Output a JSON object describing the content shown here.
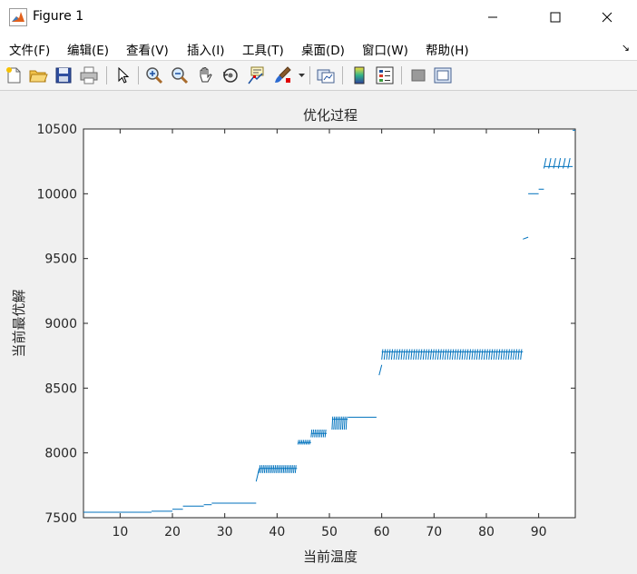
{
  "window": {
    "title": "Figure 1"
  },
  "menu": [
    {
      "label": "文件(F)"
    },
    {
      "label": "编辑(E)"
    },
    {
      "label": "查看(V)"
    },
    {
      "label": "插入(I)"
    },
    {
      "label": "工具(T)"
    },
    {
      "label": "桌面(D)"
    },
    {
      "label": "窗口(W)"
    },
    {
      "label": "帮助(H)"
    }
  ],
  "toolbar_icons": [
    "new-figure-icon",
    "open-folder-icon",
    "save-icon",
    "print-icon",
    "pointer-icon",
    "zoom-in-icon",
    "zoom-out-icon",
    "pan-hand-icon",
    "rotate-3d-icon",
    "data-cursor-icon",
    "brush-icon",
    "link-plot-icon",
    "colorbar-icon",
    "legend-icon",
    "hide-plot-tools-icon",
    "show-plot-tools-icon"
  ],
  "colors": {
    "line": "#0072bd",
    "axes_bg": "#ffffff",
    "figure_bg": "#f0f0f0"
  },
  "chart_data": {
    "type": "line",
    "title": "优化过程",
    "xlabel": "当前温度",
    "ylabel": "当前最优解",
    "xlim": [
      3,
      97
    ],
    "ylim": [
      7500,
      10500
    ],
    "xticks": [
      10,
      20,
      30,
      40,
      50,
      60,
      70,
      80,
      90
    ],
    "yticks": [
      7500,
      8000,
      8500,
      9000,
      9500,
      10000,
      10500
    ],
    "grid": false,
    "segments": [
      {
        "x": [
          3,
          16
        ],
        "y": [
          7542,
          7542
        ]
      },
      {
        "x": [
          16,
          20
        ],
        "y": [
          7550,
          7550
        ]
      },
      {
        "x": [
          20,
          22
        ],
        "y": [
          7565,
          7565
        ]
      },
      {
        "x": [
          22,
          26
        ],
        "y": [
          7590,
          7590
        ]
      },
      {
        "x": [
          26,
          27.5
        ],
        "y": [
          7600,
          7600
        ]
      },
      {
        "x": [
          27.5,
          36
        ],
        "y": [
          7612,
          7612
        ]
      },
      {
        "x": [
          36,
          36.6
        ],
        "y": [
          7780,
          7880
        ]
      },
      {
        "x": [
          36.6,
          43.8
        ],
        "y": [
          7880,
          7880
        ]
      },
      {
        "x": [
          44,
          46.5
        ],
        "y": [
          8080,
          8080
        ]
      },
      {
        "x": [
          46.5,
          49.5
        ],
        "y": [
          8150,
          8150
        ]
      },
      {
        "x": [
          50.5,
          53.5
        ],
        "y": [
          8260,
          8260
        ]
      },
      {
        "x": [
          53.5,
          59
        ],
        "y": [
          8275,
          8275
        ]
      },
      {
        "x": [
          59.5,
          60
        ],
        "y": [
          8600,
          8680
        ]
      },
      {
        "x": [
          60,
          87
        ],
        "y": [
          8780,
          8780
        ]
      },
      {
        "x": [
          87,
          88
        ],
        "y": [
          9650,
          9665
        ]
      },
      {
        "x": [
          88,
          90
        ],
        "y": [
          10000,
          10000
        ]
      },
      {
        "x": [
          90,
          91
        ],
        "y": [
          10035,
          10035
        ]
      },
      {
        "x": [
          91,
          96.5
        ],
        "y": [
          10210,
          10210
        ]
      },
      {
        "x": [
          96.5,
          97
        ],
        "y": [
          10490,
          10490
        ]
      }
    ],
    "oscillations": [
      {
        "x_start": 36.6,
        "x_end": 43.8,
        "y_low": 7845,
        "y_high": 7905,
        "count": 22
      },
      {
        "x_start": 44,
        "x_end": 46.5,
        "y_low": 8065,
        "y_high": 8100,
        "count": 8
      },
      {
        "x_start": 46.5,
        "x_end": 49.5,
        "y_low": 8120,
        "y_high": 8180,
        "count": 9
      },
      {
        "x_start": 50.5,
        "x_end": 53.5,
        "y_low": 8180,
        "y_high": 8280,
        "count": 9
      },
      {
        "x_start": 60,
        "x_end": 87,
        "y_low": 8720,
        "y_high": 8800,
        "count": 58
      },
      {
        "x_start": 91,
        "x_end": 96.5,
        "y_low": 10195,
        "y_high": 10275,
        "count": 6
      }
    ]
  }
}
